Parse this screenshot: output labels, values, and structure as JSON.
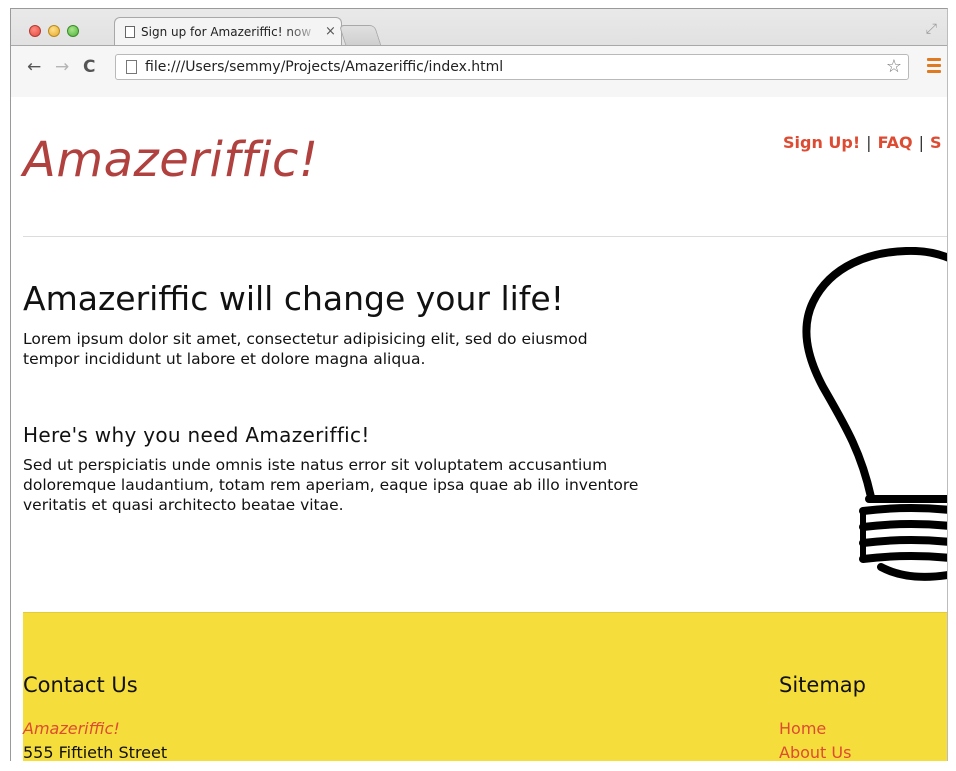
{
  "browser": {
    "tab_title": "Sign up for Amazeriffic! now",
    "tab_close": "×",
    "url": "file:///Users/semmy/Projects/Amazeriffic/index.html",
    "back": "←",
    "forward": "→",
    "reload": "C",
    "star": "☆",
    "resize": "⤢"
  },
  "page": {
    "logo": "Amazeriffic!",
    "nav": [
      {
        "label": "Sign Up!"
      },
      {
        "label": "FAQ"
      },
      {
        "label": "S"
      }
    ],
    "nav_separator": "|",
    "headline": "Amazeriffic will change your life!",
    "paragraph1": "Lorem ipsum dolor sit amet, consectetur adipisicing elit, sed do eiusmod tempor incididunt ut labore et dolore magna aliqua.",
    "subheadline": "Here's why you need Amazeriffic!",
    "paragraph2": "Sed ut perspiciatis unde omnis iste natus error sit voluptatem accusantium doloremque laudantium, totam rem aperiam, eaque ipsa quae ab illo inventore veritatis et quasi architecto beatae vitae."
  },
  "footer": {
    "contact_title": "Contact Us",
    "contact_name": "Amazeriffic!",
    "contact_address": "555 Fiftieth Street",
    "sitemap_title": "Sitemap",
    "sitemap_links": [
      "Home",
      "About Us"
    ]
  },
  "colors": {
    "logo": "#b0413e",
    "link": "#de4b33",
    "footer_bg": "#f5dd3c"
  },
  "icons": {
    "lightbulb": "lightbulb-illustration",
    "menu": "hamburger-menu-icon"
  }
}
